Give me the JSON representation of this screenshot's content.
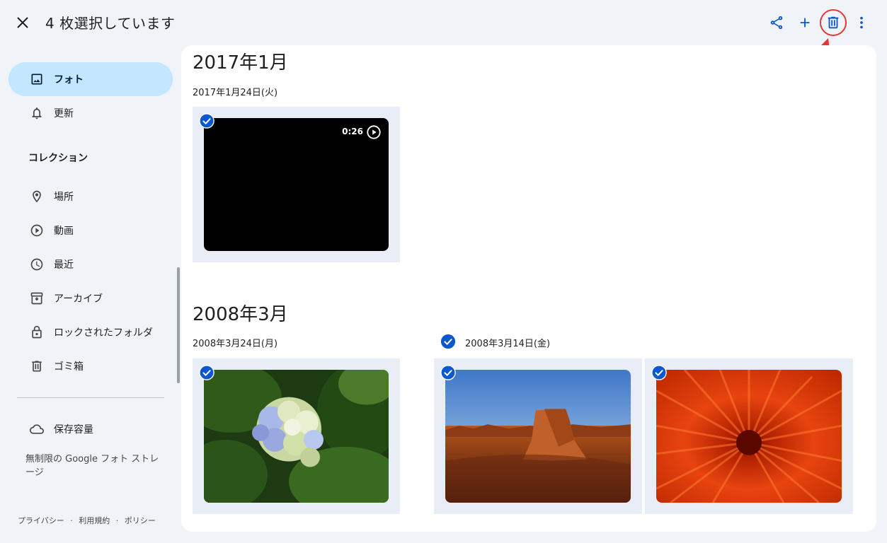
{
  "header": {
    "selection_title": "4 枚選択しています",
    "actions": [
      "share-icon",
      "add-icon",
      "trash-icon",
      "more-vert-icon"
    ],
    "annotation_number": "4",
    "accent_color": "#0b57d0",
    "annotation_color": "#e53935"
  },
  "sidebar": {
    "items": [
      {
        "label": "フォト",
        "icon": "photo-icon",
        "active": true
      },
      {
        "label": "更新",
        "icon": "bell-icon"
      }
    ],
    "collection_label": "コレクション",
    "collections": [
      {
        "label": "場所",
        "icon": "location-pin-icon"
      },
      {
        "label": "動画",
        "icon": "play-circle-icon"
      },
      {
        "label": "最近",
        "icon": "clock-icon"
      },
      {
        "label": "アーカイブ",
        "icon": "archive-icon"
      },
      {
        "label": "ロックされたフォルダ",
        "icon": "lock-icon"
      },
      {
        "label": "ゴミ箱",
        "icon": "trash-icon"
      }
    ],
    "storage_label": "保存容量",
    "storage_sub": "無制限の Google フォト ストレージ",
    "footer": {
      "privacy": "プライバシー",
      "terms": "利用規約",
      "policy": "ポリシー",
      "sep": "·"
    },
    "active_color": "#c2e7ff"
  },
  "main": {
    "groups": [
      {
        "month": "2017年1月",
        "days": [
          {
            "date": "2017年1月24日(火)",
            "photos": [
              {
                "kind": "video",
                "duration": "0:26",
                "selected": true
              }
            ]
          }
        ]
      },
      {
        "month": "2008年3月",
        "days": [
          {
            "date": "2008年3月24日(月)",
            "photos": [
              {
                "kind": "hydrangea",
                "selected": true
              }
            ]
          },
          {
            "date": "2008年3月14日(金)",
            "date_selected": true,
            "photos": [
              {
                "kind": "desert",
                "selected": true
              },
              {
                "kind": "chrysanthemum",
                "selected": true
              }
            ]
          }
        ]
      }
    ]
  }
}
